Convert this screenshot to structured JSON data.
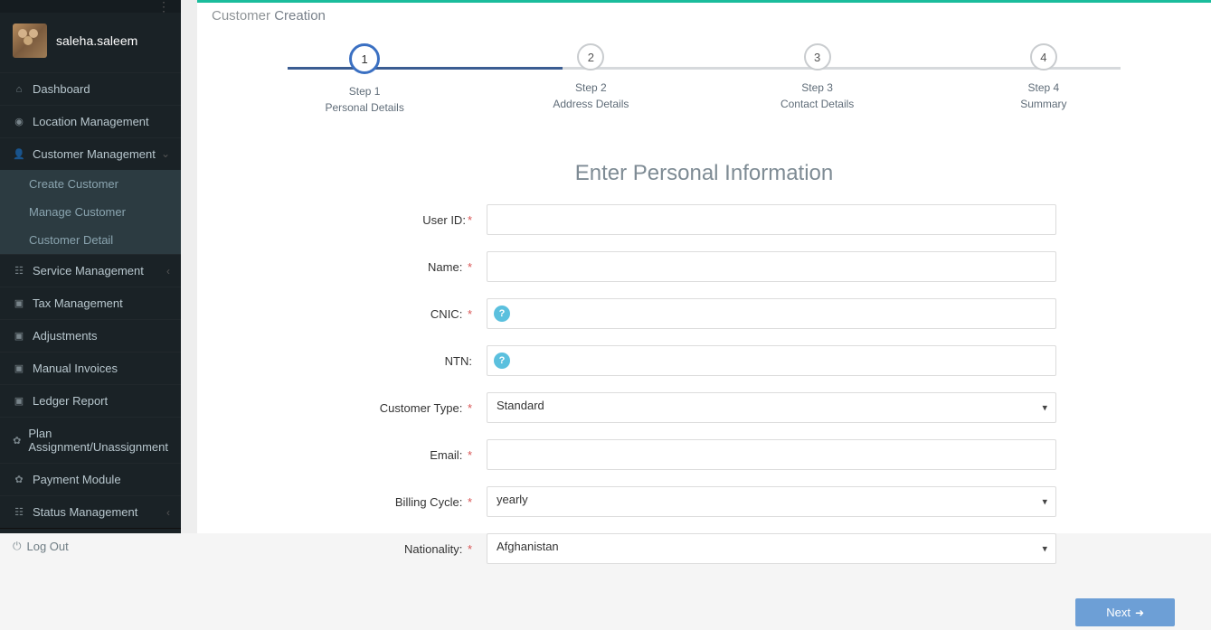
{
  "user": {
    "name": "saleha.saleem"
  },
  "sidebar": {
    "items": [
      {
        "label": "Dashboard",
        "icon": "⌂"
      },
      {
        "label": "Location Management",
        "icon": "◉"
      },
      {
        "label": "Customer Management",
        "icon": "👤",
        "open": true
      },
      {
        "label": "Service Management",
        "icon": "☷"
      },
      {
        "label": "Tax Management",
        "icon": "▣"
      },
      {
        "label": "Adjustments",
        "icon": "▣"
      },
      {
        "label": "Manual Invoices",
        "icon": "▣"
      },
      {
        "label": "Ledger Report",
        "icon": "▣"
      },
      {
        "label": "Plan Assignment/Unassignment",
        "icon": "✿"
      },
      {
        "label": "Payment Module",
        "icon": "✿"
      },
      {
        "label": "Status Management",
        "icon": "☷"
      }
    ],
    "customer_sub": [
      {
        "label": "Create Customer"
      },
      {
        "label": "Manage Customer"
      },
      {
        "label": "Customer Detail"
      }
    ]
  },
  "logout_label": "Log Out",
  "page": {
    "title_prefix": "Customer ",
    "title_bold": "Creation"
  },
  "wizard": {
    "steps": [
      {
        "num": "1",
        "title": "Step 1",
        "subtitle": "Personal Details",
        "active": true
      },
      {
        "num": "2",
        "title": "Step 2",
        "subtitle": "Address Details"
      },
      {
        "num": "3",
        "title": "Step 3",
        "subtitle": "Contact Details"
      },
      {
        "num": "4",
        "title": "Step 4",
        "subtitle": "Summary"
      }
    ],
    "line_done_pct": 33
  },
  "form": {
    "heading": "Enter Personal Information",
    "fields": {
      "user_id": {
        "label": "User ID:",
        "required": true,
        "value": ""
      },
      "name": {
        "label": "Name:",
        "required": true,
        "value": ""
      },
      "cnic": {
        "label": "CNIC:",
        "required": true,
        "value": "",
        "help": "?"
      },
      "ntn": {
        "label": "NTN:",
        "required": false,
        "value": "",
        "help": "?"
      },
      "customer_type": {
        "label": "Customer Type:",
        "required": true,
        "value": "Standard"
      },
      "email": {
        "label": "Email:",
        "required": true,
        "value": ""
      },
      "billing_cycle": {
        "label": "Billing Cycle:",
        "required": true,
        "value": "yearly"
      },
      "nationality": {
        "label": "Nationality:",
        "required": true,
        "value": "Afghanistan"
      }
    },
    "next_label": "Next"
  }
}
